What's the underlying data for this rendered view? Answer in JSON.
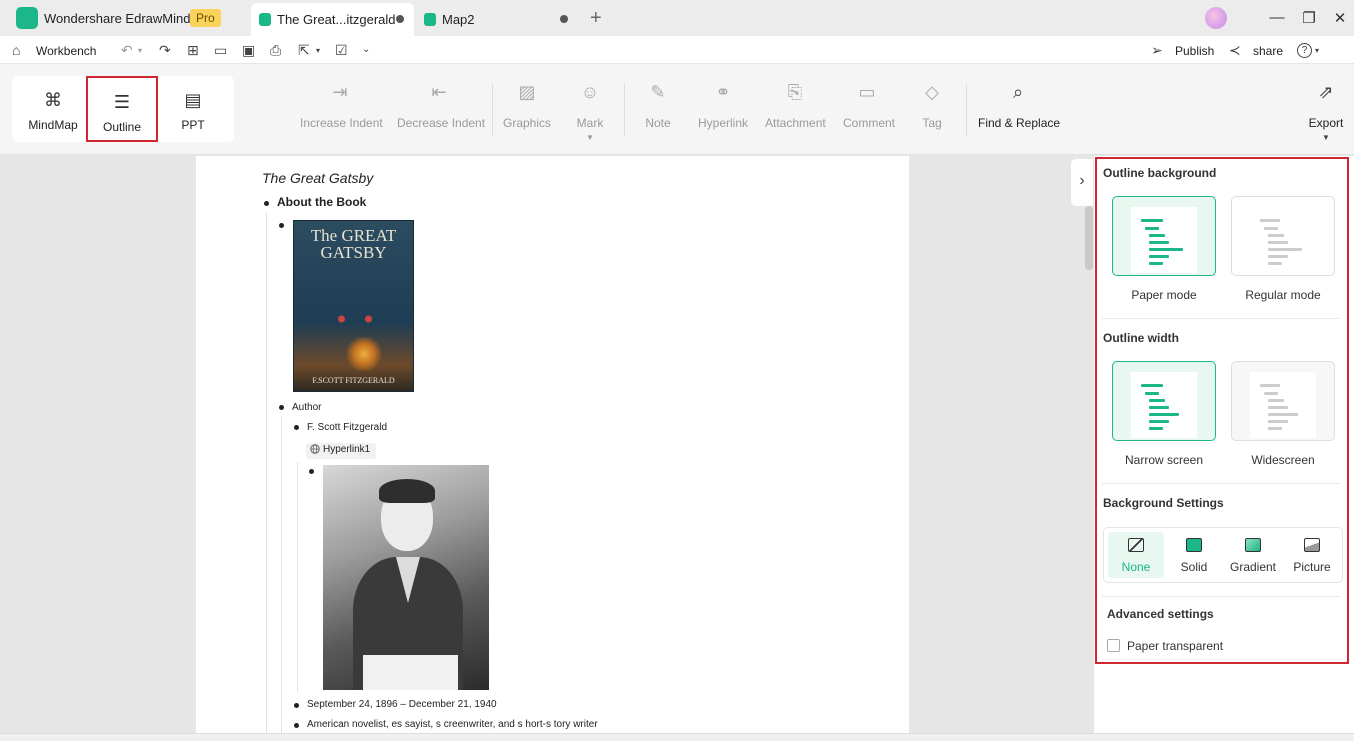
{
  "app": {
    "name": "Wondershare EdrawMind",
    "badge": "Pro"
  },
  "tabs": [
    {
      "title": "The Great...itzgerald",
      "active": true
    },
    {
      "title": "Map2",
      "active": false
    }
  ],
  "quick": {
    "workbench": "Workbench",
    "publish": "Publish",
    "share": "share",
    "help": "?"
  },
  "views": [
    {
      "label": "MindMap",
      "icon": "mindmap-icon"
    },
    {
      "label": "Outline",
      "icon": "outline-icon",
      "selected": true
    },
    {
      "label": "PPT",
      "icon": "ppt-icon"
    }
  ],
  "tools": {
    "increase_indent": "Increase Indent",
    "decrease_indent": "Decrease Indent",
    "graphics": "Graphics",
    "mark": "Mark",
    "note": "Note",
    "hyperlink": "Hyperlink",
    "attachment": "Attachment",
    "comment": "Comment",
    "tag": "Tag",
    "find_replace": "Find & Replace",
    "export": "Export"
  },
  "outline": {
    "title": "The Great Gatsby",
    "about": "About the Book",
    "book_cover": {
      "title_line1": "The GREAT",
      "title_line2": "GATSBY",
      "author": "F.SCOTT FITZGERALD"
    },
    "author": "Author",
    "author_name": "F. Scott Fitzgerald",
    "hyperlink": "Hyperlink1",
    "dates": "September 24, 1896 – December 21, 1940",
    "occupation": "American novelist, es sayist, s creenwriter, and s hort-s tory writer"
  },
  "panel": {
    "bg_heading": "Outline background",
    "paper_mode": "Paper mode",
    "regular_mode": "Regular mode",
    "width_heading": "Outline width",
    "narrow": "Narrow screen",
    "wide": "Widescreen",
    "bg_settings": "Background Settings",
    "bg_options": [
      "None",
      "Solid",
      "Gradient",
      "Picture"
    ],
    "bg_selected": "None",
    "advanced": "Advanced settings",
    "paper_transparent": "Paper transparent"
  },
  "colors": {
    "accent": "#1bb789",
    "highlight": "#d0262f",
    "pro_badge": "#fbd35a"
  }
}
